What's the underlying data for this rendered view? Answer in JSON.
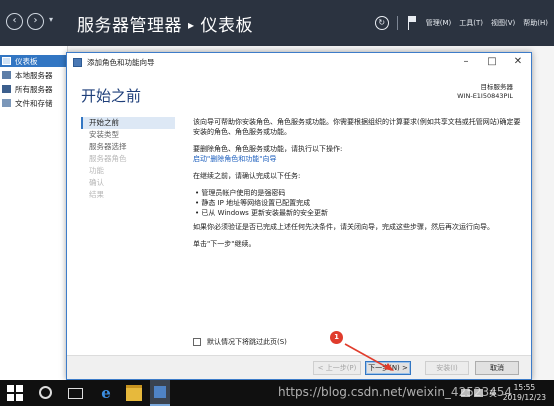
{
  "server_manager": {
    "title": "服务器管理器",
    "separator": "▸",
    "current_page": "仪表板",
    "menus": [
      "管理(M)",
      "工具(T)",
      "视图(V)",
      "帮助(H)"
    ],
    "nav": [
      "仪表板",
      "本地服务器",
      "所有服务器",
      "文件和存储"
    ]
  },
  "wizard": {
    "window_title": "添加角色和功能向导",
    "heading": "开始之前",
    "destination_label": "目标服务器",
    "destination_value": "WIN-E1I50843PIL",
    "steps": [
      {
        "label": "开始之前",
        "state": "current"
      },
      {
        "label": "安装类型",
        "state": "normal"
      },
      {
        "label": "服务器选择",
        "state": "normal"
      },
      {
        "label": "服务器角色",
        "state": "disabled"
      },
      {
        "label": "功能",
        "state": "disabled"
      },
      {
        "label": "确认",
        "state": "disabled"
      },
      {
        "label": "结果",
        "state": "disabled"
      }
    ],
    "intro": "该向导可帮助你安装角色、角色服务或功能。你需要根据组织的计算要求(例如共享文档或托管网站)确定要安装的角色、角色服务或功能。",
    "remove_text": "要删除角色、角色服务或功能，请执行以下操作:",
    "remove_link": "启动\"删除角色和功能\"向导",
    "before_text": "在继续之前，请确认完成以下任务:",
    "bullets": [
      "管理员帐户使用的是强密码",
      "静态 IP 地址等网络设置已配置完成",
      "已从 Windows 更新安装最新的安全更新"
    ],
    "verify_text": "如果你必须验证是否已完成上述任何先决条件，请关闭向导，完成这些步骤，然后再次运行向导。",
    "continue_text": "单击\"下一步\"继续。",
    "skip_label": "默认情况下将跳过此页(S)",
    "buttons": {
      "prev": "< 上一步(P)",
      "next": "下一步(N) >",
      "install": "安装(I)",
      "cancel": "取消"
    }
  },
  "annotation": {
    "badge": "1"
  },
  "taskbar": {
    "ime": "英",
    "time": "15:55",
    "date": "2019/12/23"
  },
  "watermark": "https://blog.csdn.net/weixin_42523454"
}
